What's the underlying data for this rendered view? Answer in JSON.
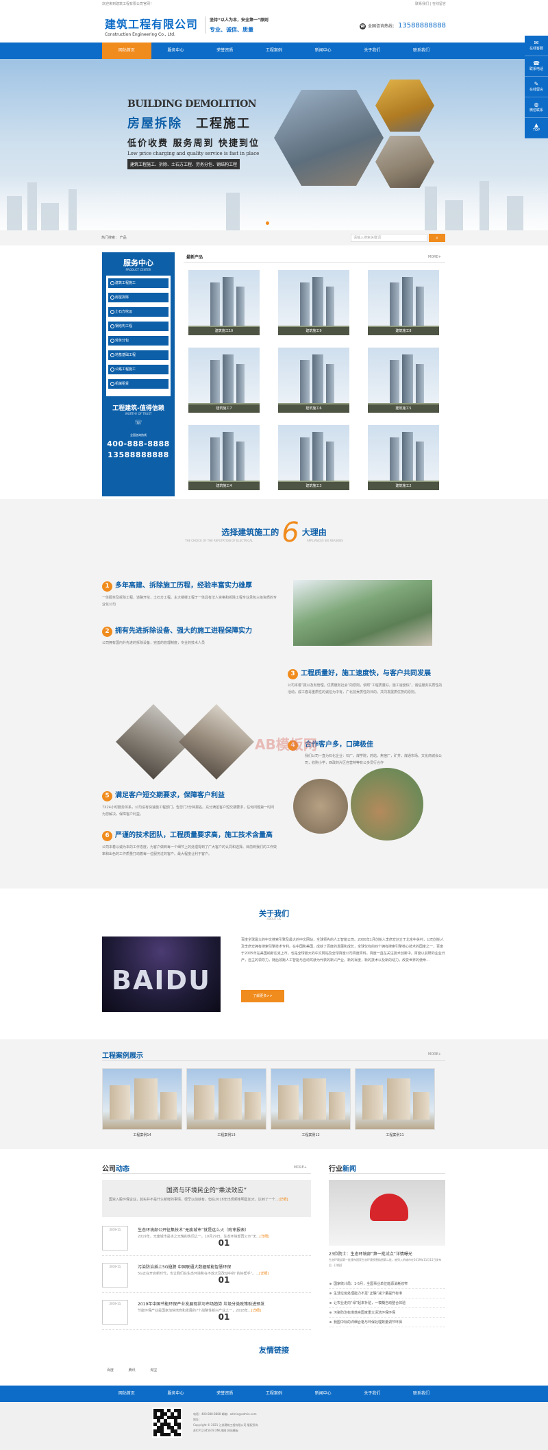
{
  "topbar": {
    "welcome": "欢迎来到建筑工程有限公司官网！",
    "links": "联系我们 | 在线留言"
  },
  "header": {
    "logo_cn": "建筑工程有限公司",
    "logo_en": "Construction Engineering Co., Ltd.",
    "slogan_a": "坚持“以人为本，安全第一”原则",
    "slogan_b": "专业、诚信、质量",
    "hotline_label": "全国咨询热线：",
    "hotline": "13588888888"
  },
  "nav": [
    "网站首页",
    "服务中心",
    "荣誉资质",
    "工程案例",
    "新闻中心",
    "关于我们",
    "联系我们"
  ],
  "banner": {
    "en": "BUILDING DEMOLITION",
    "cn_a": "房屋拆除",
    "cn_b": "工程施工",
    "slogan": "低价收费 服务周到 快捷到位",
    "slogan_en": "Low price charging and quality service is fast in place",
    "services": "建筑工程施工、拆除、土石方工程、劳务分包、钢结构工程"
  },
  "search": {
    "hot_label": "热门搜索：  产品",
    "placeholder": "请输入搜索关键词",
    "btn_icon": "search-icon"
  },
  "sidebar": {
    "title": "服务中心",
    "title_en": "PRODUCT CENTER",
    "items": [
      "建筑工程施工",
      "房屋拆除",
      "土石方挖运",
      "钢结构工程",
      "劳务分包",
      "地基基础工程",
      "公路工程施工",
      "机械租赁"
    ],
    "trust": "工程建筑-值得信赖",
    "trust_en": "WORTHY OF TRUST",
    "tel_label": "全国咨询热线",
    "tel1": "400-888-8888",
    "tel2": "13588888888"
  },
  "products": {
    "title": "最新产品",
    "more": "MORE+",
    "items": [
      "建筑施工10",
      "建筑施工9",
      "建筑施工8",
      "建筑施工7",
      "建筑施工6",
      "建筑施工5",
      "建筑施工4",
      "建筑施工3",
      "建筑施工2"
    ]
  },
  "reasons": {
    "title_a": "选择建筑施工的",
    "six": "6",
    "title_b": "大理由",
    "sub_a": "THE CHOICE OF THE REPUTATION OF ELECTRICAL",
    "sub_b": "APPLIANCES SIX REASONS",
    "watermark": "AB模板网",
    "items": [
      {
        "num": "1",
        "title": "多年高建、拆除施工历程，经验丰富实力雄厚",
        "text": "一体服务及拆除工程，道路开挖，土石方工程。主大楼楼工程于一体具有法人资格和拆除工程专业承包三级资质的专业化公司"
      },
      {
        "num": "2",
        "title": "拥有先进拆除设备、强大的施工进程保障实力",
        "text": "公司拥有国内外先进的拆除设备，完善的管理制度，专业的技术人员"
      },
      {
        "num": "3",
        "title": "工程质量好，施工速度快，与客户共同发展",
        "text": "公司本着“报以及有管理，优质服务社会”的原则，依照“工程质量好，施工速度快”，诚信服务实质性的活动，成工春哥重质性的诚信为中有，广北前贡质性的日的，共同发展质优势的原则。"
      },
      {
        "num": "4",
        "title": "合作客户多，口碑极佳",
        "text": "我们公司一直为石化企业：石厂，煤学院，药站，焦宿厂，矿井，煤通市场，文化商城会公司，收购小学，西政的片区自营特等有公多员行合作"
      },
      {
        "num": "5",
        "title": "满足客户短交期要求，保障客户利益",
        "text": "7X24小时服务体系，公司设有快速施工程部门，告您门3分钟报名。充分满足客户短交期要求，任何问题第一时间为您解决，保障客户利益。"
      },
      {
        "num": "6",
        "title": "严谨的技术团队，工程质量要求高，施工技术含量高",
        "text": "公司本着以诚为本的工作态度，为客户做到每一个细节上的处理得到了广大客户的认同和选择。目前到我们的工作效率和出色的工作质量打动着每一位服务过的客户。最大程度让利于客户。"
      }
    ]
  },
  "about": {
    "title": "关于我们",
    "sub": "ABOUT US",
    "image_word": "BAIDU",
    "text": "百度全球最大的中文搜索引擎及最大的中文网站，全球领先的人工智能公司。2000年1月创始人李彦宏创立于北京中关村，公司创始人及李彦宏拥有搜索引擎技术专利。在中国和美国，成就了百度的发展和成长，全球仅有的四个拥有搜索引擎核心技术的国家之一，百度于2005年在美国纳斯达克上市，也是全球最大的中文网站及全球百度公司百度百科。百度一直在关注技术创新中。百度以前研的企业日产，自主的领导力，随后领跑人工智能与自动驾驶为代表的新兴产业。新的百度，新的技术以及新的动力，改变世界的使命…",
    "btn": "了解更多>>"
  },
  "cases": {
    "title": "工程案例展示",
    "more": "MORE+",
    "items": [
      "工程案例14",
      "工程案例13",
      "工程案例12",
      "工程案例11"
    ]
  },
  "news": {
    "left_title_a": "公司",
    "left_title_b": "动态",
    "more": "MORE+",
    "feature_title": "国资与环境民企的“乘法效应”",
    "feature_text": "国资入股环保企业，其实并不是什么新鲜的事情，很早以前就有。但在2018年出现频率明显加大，达到了一个...",
    "feature_more": "[详细]",
    "items": [
      {
        "day": "01",
        "ym": "2019-11",
        "title": "生态环境部公开征集技术“无废城市”就是这么火（附审报表）",
        "text": "2019年，无废城市是当之无愧的热词之一。10月29日，生态环境部再公示“无…",
        "more": "[详细]"
      },
      {
        "day": "01",
        "ym": "2019-11",
        "title": "污染防治插上5G翅膀 中国联通大数据赋能智慧环保",
        "text": "5G正在开启新时代，也让我们在生态环境和在不放大及改动中的“的好帮手”。…",
        "more": "[详细]"
      },
      {
        "day": "01",
        "ym": "2019-11",
        "title": "2019年中国节能环保产业发展现状与市场趋势 垃圾分类政策助进预发",
        "text": "节能环保产业是国家加快培育和发展的7个战略性新兴产业之一，2018年…",
        "more": "[详细]"
      }
    ],
    "right_title_a": "行业",
    "right_title_b": "新闻",
    "right_feature_title": "23位院士：生态环境部“第一批试点”详情曝光",
    "right_feature_text": "生态环境部第一批颁布国家生态环境损害赔偿第二批，被列入的城市在2019年11月15日发布后…[详细]",
    "list": [
      "国家统计局：1-5月，全国事业单位能源消耗收窄",
      "生活垃圾处理能力不足“正确”减少量提升标准",
      "让农业走向“绿”起来补贴，一模糊自动整合体验",
      "污染防治标准落实国家重大清洁环保环保",
      "我国中标的详细合格与环保处理数量调节环保"
    ]
  },
  "links": {
    "title": "友情链接",
    "items": [
      "百度",
      "腾讯",
      "淘宝"
    ]
  },
  "footer": {
    "line1": "电话：400-888-8888  邮箱：admin@admin.com",
    "line2": "地址：",
    "line3": "Copyright © 2021 江苏建筑工程有限公司 版权所有",
    "line4": "苏ICP12345678 XML地图 网站模板"
  },
  "float": [
    {
      "icon": "chat-icon",
      "label": "在线客服"
    },
    {
      "icon": "phone-icon",
      "label": "联系电话"
    },
    {
      "icon": "message-icon",
      "label": "在线留言"
    },
    {
      "icon": "wechat-icon",
      "label": "微信联系"
    },
    {
      "icon": "top-icon",
      "label": "TOP"
    }
  ]
}
